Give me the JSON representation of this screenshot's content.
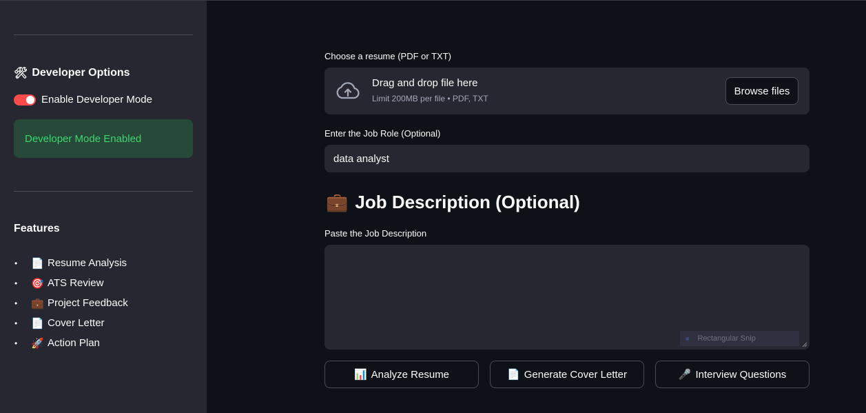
{
  "sidebar": {
    "dev_heading_icon": "🛠",
    "dev_heading": "Developer Options",
    "toggle_label": "Enable Developer Mode",
    "toggle_on": true,
    "alert_text": "Developer Mode Enabled",
    "features_heading": "Features",
    "features": [
      {
        "icon": "📄",
        "label": "Resume Analysis"
      },
      {
        "icon": "🎯",
        "label": "ATS Review"
      },
      {
        "icon": "💼",
        "label": "Project Feedback"
      },
      {
        "icon": "📄",
        "label": "Cover Letter"
      },
      {
        "icon": "🚀",
        "label": "Action Plan"
      }
    ]
  },
  "main": {
    "upload_label": "Choose a resume (PDF or TXT)",
    "upload_title": "Drag and drop file here",
    "upload_sub": "Limit 200MB per file • PDF, TXT",
    "browse_label": "Browse files",
    "role_label": "Enter the Job Role (Optional)",
    "role_value": "data analyst",
    "jd_icon": "💼",
    "jd_title": "Job Description (Optional)",
    "jd_label": "Paste the Job Description",
    "jd_value": "",
    "snip_overlay": "Rectangular Snip",
    "buttons": [
      {
        "icon": "📊",
        "label": "Analyze Resume"
      },
      {
        "icon": "📄",
        "label": "Generate Cover Letter"
      },
      {
        "icon": "🎤",
        "label": "Interview Questions"
      }
    ]
  },
  "colors": {
    "background": "#0e1117",
    "sidebar": "#262730",
    "accent": "#ff4b4b",
    "success_bg": "#26493a",
    "success_text": "#3dd56d"
  }
}
